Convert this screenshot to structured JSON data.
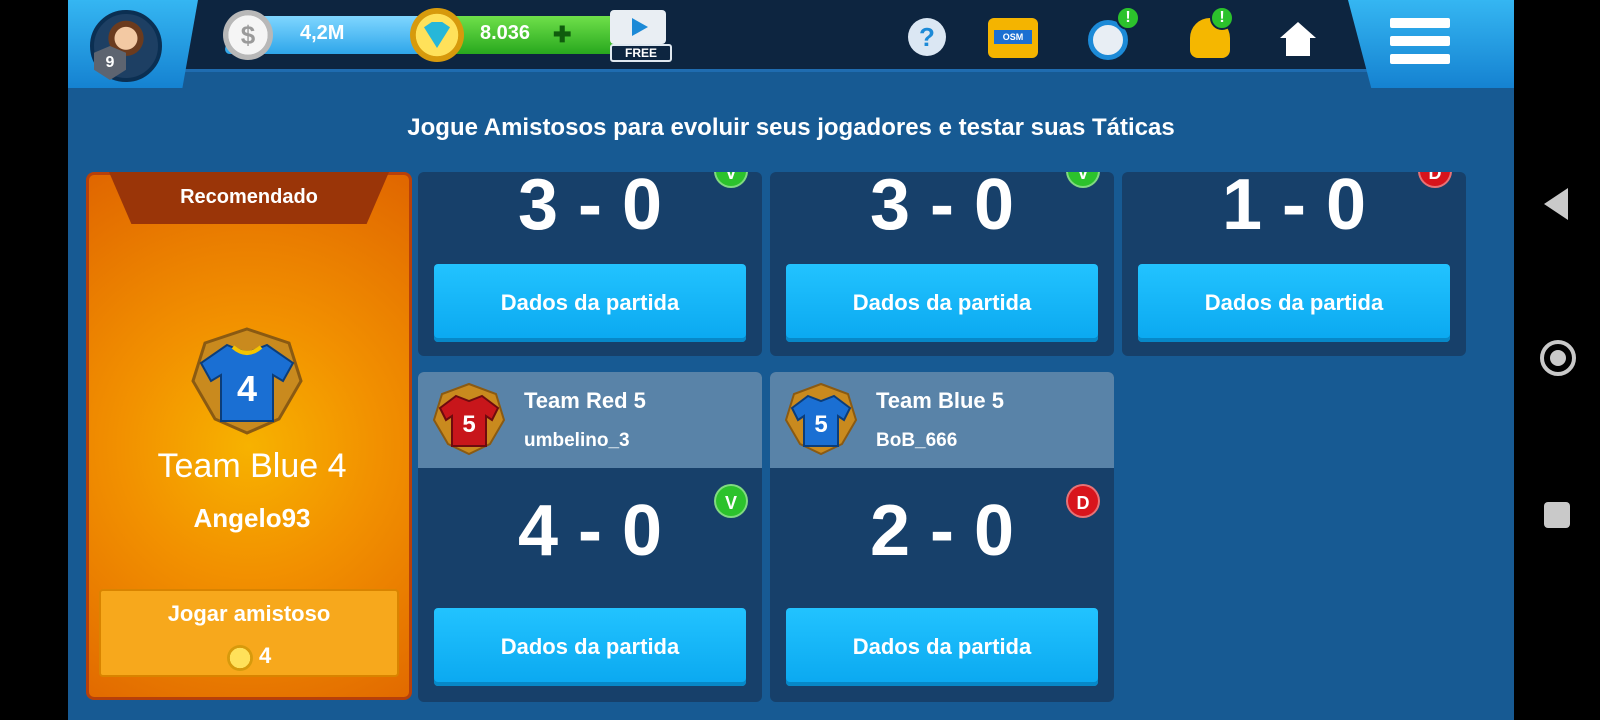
{
  "topbar": {
    "level": "9",
    "coins": "4,2M",
    "gems": "8.036",
    "free_label": "FREE",
    "osm_label": "OSM",
    "help_symbol": "?",
    "alert_symbol": "!"
  },
  "subtitle": "Jogue Amistosos para evoluir seus jogadores e testar suas Táticas",
  "recommended": {
    "header": "Recomendado",
    "shirt_number": "4",
    "team": "Team Blue 4",
    "user": "Angelo93",
    "play_label": "Jogar amistoso",
    "cost": "4"
  },
  "matches": [
    {
      "score": "3 - 0",
      "result": "V",
      "details": "Dados da partida"
    },
    {
      "score": "3 - 0",
      "result": "V",
      "details": "Dados da partida"
    },
    {
      "score": "1 - 0",
      "result": "D",
      "details": "Dados da partida"
    },
    {
      "team": "Team Red 5",
      "user": "umbelino_3",
      "shirt_number": "5",
      "shirt_color": "#c8161b",
      "score": "4 - 0",
      "result": "V",
      "details": "Dados da partida"
    },
    {
      "team": "Team Blue 5",
      "user": "BoB_666",
      "shirt_number": "5",
      "shirt_color": "#1a6fd3",
      "score": "2 - 0",
      "result": "D",
      "details": "Dados da partida"
    }
  ],
  "colors": {
    "background": "#175a93",
    "win": "#2cc22c",
    "loss": "#d8141c",
    "button": "#0aa8f0",
    "recommended": "#f29100"
  },
  "icons": [
    "avatar",
    "coin-icon",
    "gem-icon",
    "free-video-icon",
    "help-icon",
    "osm-shop-icon",
    "stopwatch-icon",
    "bell-icon",
    "home-icon",
    "menu-icon"
  ]
}
